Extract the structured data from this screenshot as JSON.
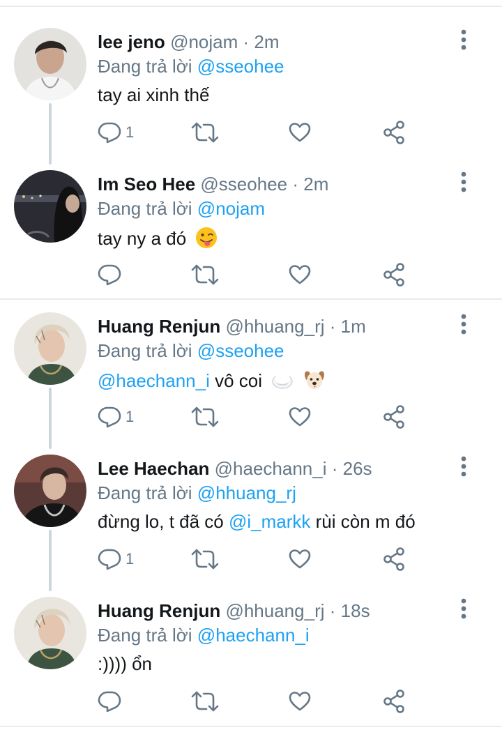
{
  "reply_prefix": "Đang trả lời",
  "tweets": [
    {
      "name": "lee jeno",
      "handle": "@nojam",
      "time": "2m",
      "reply_to": "@sseohee",
      "text": "tay ai xinh thế",
      "reply_count": "1",
      "avatar": "person-white-shirt-avatar"
    },
    {
      "name": "Im Seo Hee",
      "handle": "@sseohee",
      "time": "2m",
      "reply_to": "@nojam",
      "text": "tay ny a đó",
      "emoji": "winking-tongue-emoji",
      "reply_count": "",
      "avatar": "night-city-avatar"
    },
    {
      "name": "Huang Renjun",
      "handle": "@hhuang_rj",
      "time": "1m",
      "reply_to": "@sseohee",
      "mention": "@haechann_i",
      "text": "vô coi",
      "emojis": [
        "rice-ball-emoji",
        "dog-face-emoji"
      ],
      "reply_count": "1",
      "avatar": "blond-person-avatar"
    },
    {
      "name": "Lee Haechan",
      "handle": "@haechann_i",
      "time": "26s",
      "reply_to": "@hhuang_rj",
      "text_before": "đừng lo, t đã có",
      "mention": "@i_markk",
      "text_after": "rùi còn m đó",
      "reply_count": "1",
      "avatar": "dark-jacket-person-avatar"
    },
    {
      "name": "Huang Renjun",
      "handle": "@hhuang_rj",
      "time": "18s",
      "reply_to": "@haechann_i",
      "text": ":)))) ổn",
      "reply_count": "",
      "avatar": "blond-person-avatar"
    }
  ],
  "colors": {
    "mention": "#1da1f2",
    "secondary_text": "#657786",
    "icon": "#657786",
    "divider": "#e6ecf0",
    "thread_line": "#ccd6dd"
  }
}
